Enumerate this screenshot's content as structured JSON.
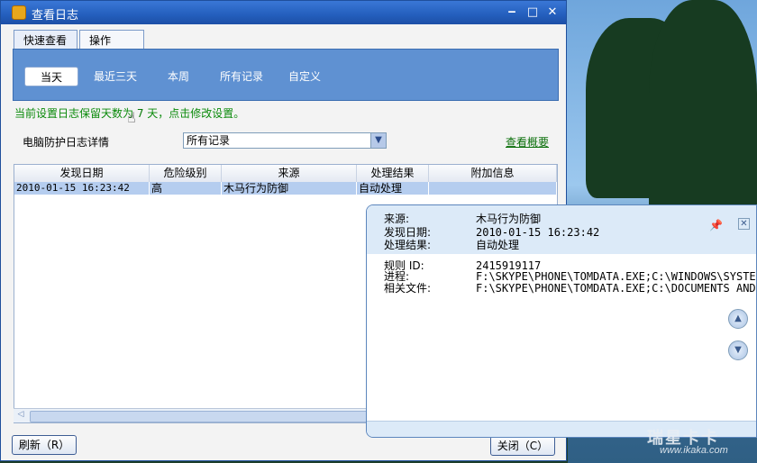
{
  "window": {
    "title": "查看日志"
  },
  "tabs": [
    {
      "label": "快速查看"
    },
    {
      "label": "操作"
    }
  ],
  "filters": [
    {
      "label": "当天"
    },
    {
      "label": "最近三天"
    },
    {
      "label": "本周"
    },
    {
      "label": "所有记录"
    },
    {
      "label": "自定义"
    }
  ],
  "hint": {
    "before": "当前设置日志保留天数为 ",
    "days": "7",
    "after": " 天，点击修改设置。"
  },
  "detail_section": {
    "label": "电脑防护日志详情",
    "select_value": "所有记录",
    "summary_link": "查看概要"
  },
  "table": {
    "headers": [
      "发现日期",
      "危险级别",
      "来源",
      "处理结果",
      "附加信息"
    ],
    "rows": [
      [
        "2010-01-15 16:23:42",
        "高",
        "木马行为防御",
        "自动处理",
        ""
      ]
    ]
  },
  "buttons": {
    "refresh": "刷新（R）",
    "close": "关闭（C）"
  },
  "popup": {
    "source_label": "来源:",
    "source_value": "木马行为防御",
    "date_label": "发现日期:",
    "date_value": "2010-01-15 16:23:42",
    "result_label": "处理结果:",
    "result_value": "自动处理",
    "rule_label": "规则 ID:",
    "rule_value": "2415919117",
    "process_label": "进程:",
    "process_value": "F:\\SKYPE\\PHONE\\TOMDATA.EXE;C:\\WINDOWS\\SYSTEM",
    "file_label": "相关文件:",
    "file_value": "F:\\SKYPE\\PHONE\\TOMDATA.EXE;C:\\DOCUMENTS AND"
  },
  "watermark": {
    "big": "瑞星卡卡",
    "small": "www.ikaka.com"
  },
  "colors": {
    "titlebar": "#245fbd",
    "tab_panel": "#5f91d2",
    "selected_row": "#b5cdef",
    "hint_green": "#0a8a0a"
  }
}
